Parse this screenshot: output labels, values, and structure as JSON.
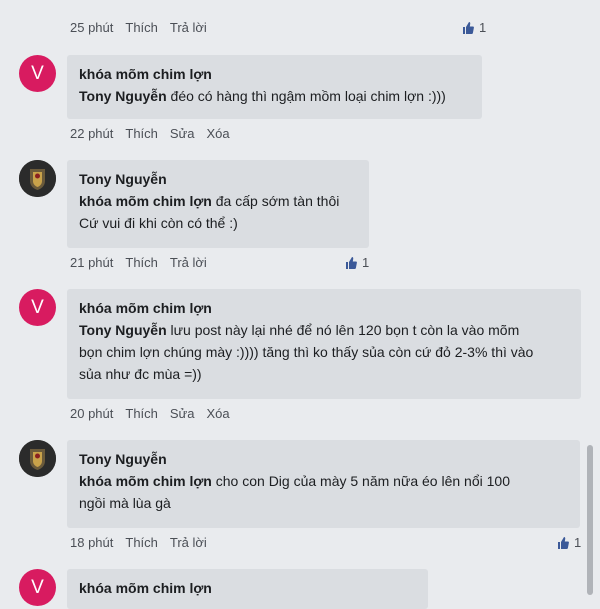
{
  "colors": {
    "background": "#e9ebee",
    "bubble": "#dadde1",
    "avatar_v": "#d81b60",
    "like_blue": "#3b5998"
  },
  "top": {
    "time": "25 phút",
    "like": "Thích",
    "reply": "Trả lời",
    "likes": "1"
  },
  "comments": [
    {
      "avatar_type": "letter",
      "avatar_letter": "V",
      "author": "khóa mõm chim lợn",
      "mention": "Tony Nguyễn",
      "lines": [
        "đéo có hàng thì ngậm mồm loại chim lợn :)))"
      ],
      "time": "22 phút",
      "like": "Thích",
      "edit": "Sửa",
      "delete": "Xóa"
    },
    {
      "avatar_type": "crest",
      "author": "Tony Nguyễn",
      "mention": "khóa mõm chim lợn",
      "first": "đa cấp sớm tàn thôi",
      "line2": "Cứ vui đi khi còn có thể :)",
      "time": "21 phút",
      "like": "Thích",
      "reply": "Trả lời",
      "likes": "1"
    },
    {
      "avatar_type": "letter",
      "avatar_letter": "V",
      "author": "khóa mõm chim lợn",
      "mention": "Tony Nguyễn",
      "first": "lưu post này lại nhé để nó lên 120 bọn t còn la vào mõm",
      "line2": "bọn chim lợn chúng mày :)))) tăng thì ko thấy sủa còn cứ đỏ 2-3% thì vào",
      "line3": "sủa như đc mùa =))",
      "time": "20 phút",
      "like": "Thích",
      "edit": "Sửa",
      "delete": "Xóa"
    },
    {
      "avatar_type": "crest",
      "author": "Tony Nguyễn",
      "mention": "khóa mõm chim lợn",
      "first": "cho con Dig của mày 5 năm nữa éo lên nổi 100",
      "line2": "ngồi mà lùa gà",
      "time": "18 phút",
      "like": "Thích",
      "reply": "Trả lời",
      "likes": "1"
    },
    {
      "avatar_type": "letter",
      "avatar_letter": "V",
      "author": "khóa mõm chim lợn"
    }
  ]
}
